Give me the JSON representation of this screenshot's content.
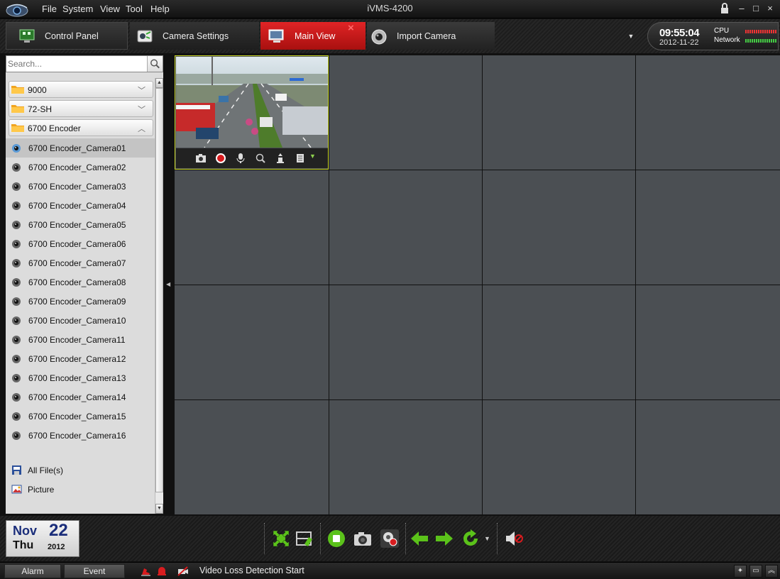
{
  "window": {
    "title": "iVMS-4200",
    "menu": [
      "File",
      "System",
      "View",
      "Tool",
      "Help"
    ],
    "controls": {
      "lock_icon": "lock-icon",
      "minimize_label": "–",
      "maximize_label": "□",
      "close_label": "×"
    }
  },
  "tabs": [
    {
      "label": "Control Panel",
      "icon": "control-panel-icon",
      "active": false
    },
    {
      "label": "Camera Settings",
      "icon": "camera-settings-icon",
      "active": false
    },
    {
      "label": "Main View",
      "icon": "monitor-icon",
      "active": true
    },
    {
      "label": "Import Camera",
      "icon": "import-camera-icon",
      "active": false
    }
  ],
  "status": {
    "time": "09:55:04",
    "date": "2012-11-22",
    "cpu_label": "CPU",
    "network_label": "Network"
  },
  "sidebar": {
    "search_placeholder": "Search...",
    "groups": [
      {
        "label": "9000",
        "expanded": false
      },
      {
        "label": "72-SH",
        "expanded": false
      },
      {
        "label": "6700 Encoder",
        "expanded": true
      }
    ],
    "cameras": [
      "6700 Encoder_Camera01",
      "6700 Encoder_Camera02",
      "6700 Encoder_Camera03",
      "6700 Encoder_Camera04",
      "6700 Encoder_Camera05",
      "6700 Encoder_Camera06",
      "6700 Encoder_Camera07",
      "6700 Encoder_Camera08",
      "6700 Encoder_Camera09",
      "6700 Encoder_Camera10",
      "6700 Encoder_Camera11",
      "6700 Encoder_Camera12",
      "6700 Encoder_Camera13",
      "6700 Encoder_Camera14",
      "6700 Encoder_Camera15",
      "6700 Encoder_Camera16"
    ],
    "selected_camera": "6700 Encoder_Camera01",
    "extras": [
      {
        "label": "All File(s)",
        "icon": "all-files-icon"
      },
      {
        "label": "Picture",
        "icon": "picture-icon"
      }
    ]
  },
  "grid": {
    "layout": "4x4",
    "active_cell": 1,
    "playing_cell": 1,
    "video_toolbar_icons": [
      "capture-icon",
      "record-icon",
      "audio-icon",
      "digital-zoom-icon",
      "ptz-icon",
      "stream-menu-icon"
    ]
  },
  "calendar": {
    "month": "Nov",
    "day": "22",
    "weekday": "Thu",
    "year": "2012"
  },
  "toolbar": {
    "buttons": [
      "fullscreen-icon",
      "window-division-icon",
      "stop-all-icon",
      "capture-icon",
      "record-icon",
      "previous-page-icon",
      "next-page-icon",
      "cycle-icon",
      "mute-icon"
    ]
  },
  "statusbar": {
    "tabs": [
      "Alarm",
      "Event"
    ],
    "message": "Video Loss Detection Start",
    "colors": {
      "accent_red": "#d81c1f",
      "selection_yellow": "#c9d624",
      "toolbar_green": "#5bc21a"
    }
  }
}
